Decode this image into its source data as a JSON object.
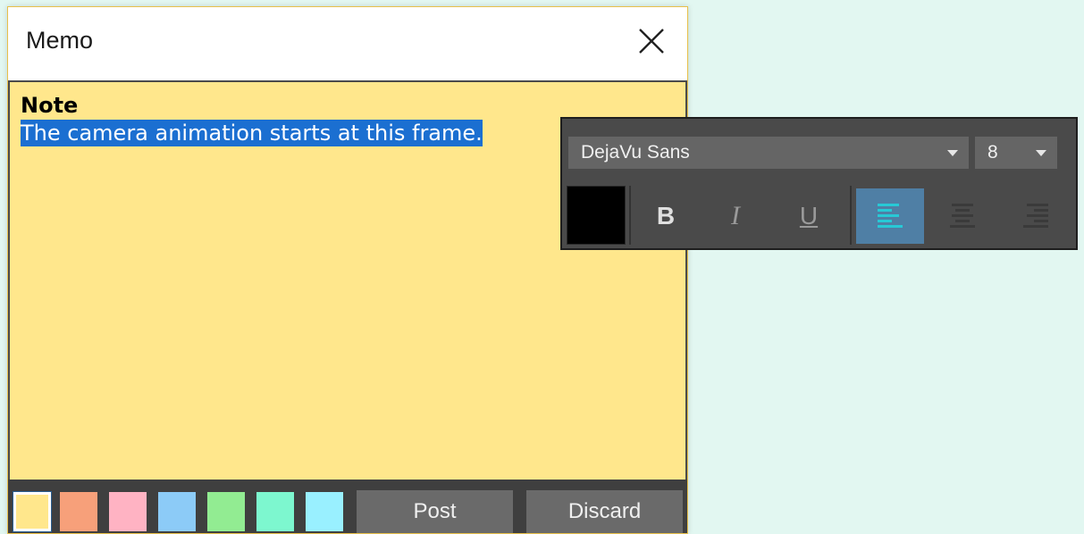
{
  "window": {
    "title": "Memo"
  },
  "note": {
    "heading": "Note",
    "selected_text": "The camera animation starts at this frame."
  },
  "swatches": [
    {
      "name": "yellow",
      "color": "#ffe78c",
      "selected": true
    },
    {
      "name": "orange",
      "color": "#f7a07a"
    },
    {
      "name": "pink",
      "color": "#ffb3c3"
    },
    {
      "name": "blue",
      "color": "#8ccbf7"
    },
    {
      "name": "green",
      "color": "#92ec92"
    },
    {
      "name": "mint",
      "color": "#7df7cf"
    },
    {
      "name": "cyan",
      "color": "#99f0ff"
    }
  ],
  "actions": {
    "post": "Post",
    "discard": "Discard"
  },
  "format_toolbar": {
    "font": "DejaVu Sans",
    "size": "8",
    "text_color": "#000000",
    "bold_glyph": "B",
    "italic_glyph": "I",
    "underline_glyph": "U",
    "alignment": "left",
    "accent": "#4f7fa5"
  }
}
